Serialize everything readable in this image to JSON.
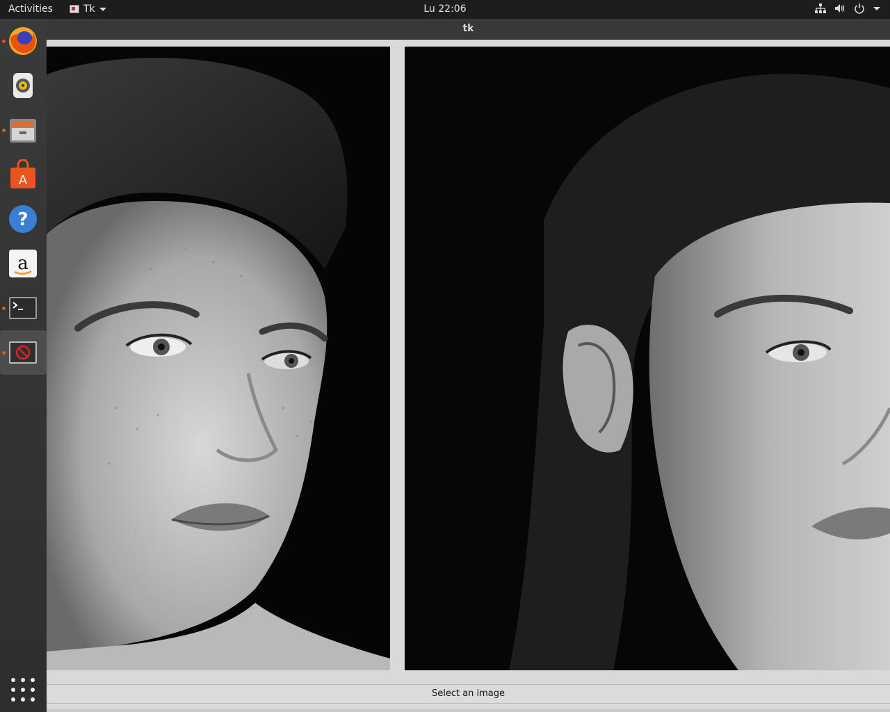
{
  "topbar": {
    "activities": "Activities",
    "app_name": "Tk",
    "clock": "Lu 22:06"
  },
  "dock": {
    "items": [
      {
        "name": "firefox",
        "running": true
      },
      {
        "name": "rhythmbox",
        "running": false
      },
      {
        "name": "files",
        "running": true
      },
      {
        "name": "software",
        "running": false
      },
      {
        "name": "help",
        "running": false
      },
      {
        "name": "amazon",
        "running": false
      },
      {
        "name": "terminal",
        "running": true
      },
      {
        "name": "tk-app",
        "running": true
      }
    ]
  },
  "window": {
    "title": "tk",
    "status": "Select an image",
    "images": [
      "left-portrait-image",
      "right-portrait-image"
    ]
  }
}
